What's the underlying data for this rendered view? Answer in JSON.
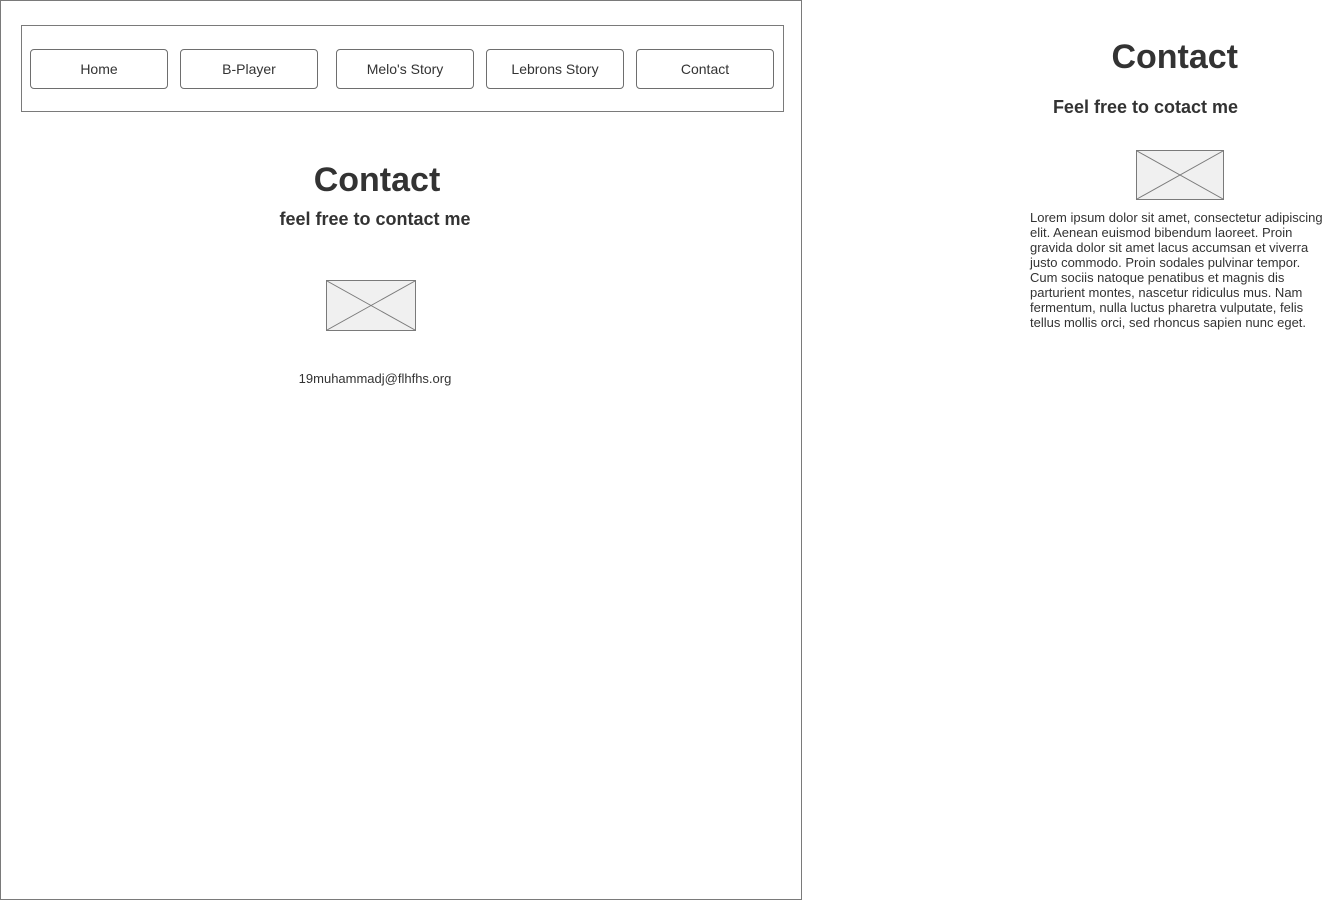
{
  "nav": {
    "items": [
      {
        "label": "Home"
      },
      {
        "label": "B-Player"
      },
      {
        "label": "Melo's Story"
      },
      {
        "label": "Lebrons Story"
      },
      {
        "label": "Contact"
      }
    ]
  },
  "left_panel": {
    "title": "Contact",
    "subtitle": "feel free to contact me",
    "email": "19muhammadj@flhfhs.org"
  },
  "right_panel": {
    "title": "Contact",
    "subtitle": "Feel free to cotact me",
    "body": "Lorem ipsum dolor sit amet, consectetur adipiscing elit. Aenean euismod bibendum laoreet. Proin gravida dolor sit amet lacus accumsan et viverra justo commodo. Proin sodales pulvinar tempor. Cum sociis natoque penatibus et magnis dis parturient montes, nascetur ridiculus mus. Nam fermentum, nulla luctus pharetra vulputate, felis tellus mollis orci, sed rhoncus sapien nunc eget."
  },
  "colors": {
    "text": "#333333",
    "border": "#7a7a7a",
    "placeholder_fill": "#f0f0f0"
  }
}
